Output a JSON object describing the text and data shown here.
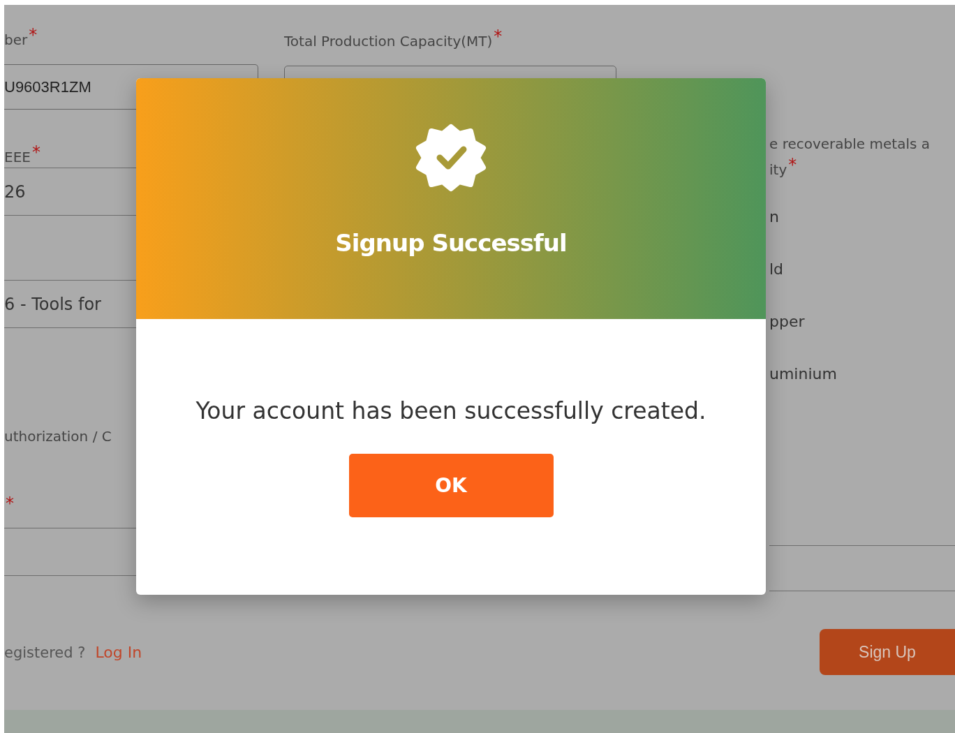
{
  "form": {
    "left_fields": [
      {
        "kind": "label",
        "text": "ber",
        "mark": "*"
      },
      {
        "kind": "boxed",
        "value": "U9603R1ZM"
      },
      {
        "kind": "label",
        "text": "EEE",
        "mark": "*"
      },
      {
        "kind": "lined",
        "value": "26"
      },
      {
        "kind": "lined",
        "value": "6 - Tools for"
      },
      {
        "kind": "label",
        "text": "uthorization / C"
      },
      {
        "kind": "label",
        "mark": "*"
      },
      {
        "kind": "lined"
      }
    ],
    "capacity_field": {
      "label": "Total Production Capacity(MT)",
      "mark": "*"
    },
    "metals": {
      "label_lines": [
        "e recoverable metals a",
        "ity"
      ],
      "mark": "*",
      "options": [
        "n",
        "ld",
        "pper",
        "uminium"
      ]
    }
  },
  "login_prompt": {
    "text": "egistered ?",
    "link": "Log In"
  },
  "signup_button": "Sign Up",
  "dialog": {
    "title": "Signup Successful",
    "message": "Your account has been successfully created.",
    "button": "OK"
  }
}
